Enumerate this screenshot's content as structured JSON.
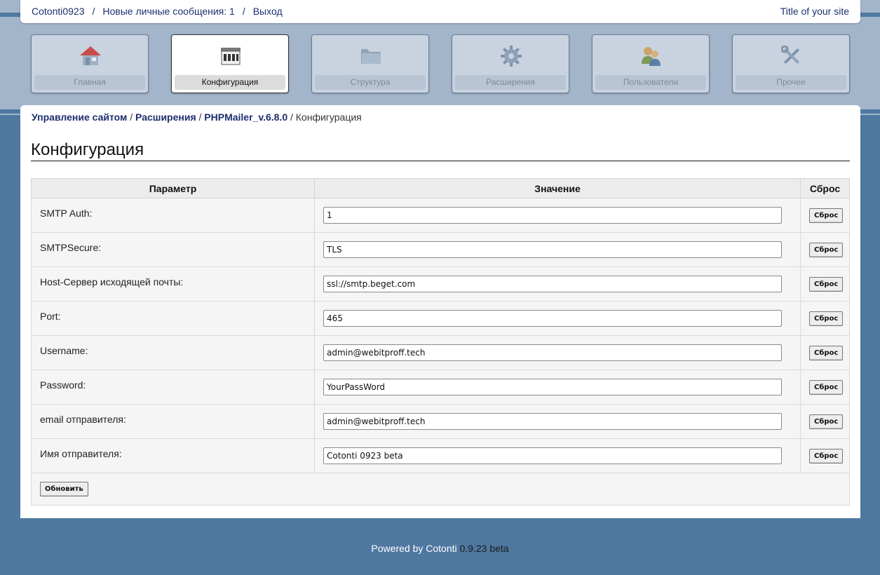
{
  "topbar": {
    "user_link": "Cotonti0923",
    "separator": "/",
    "messages_link": "Новые личные сообщения: 1",
    "logout_link": "Выход",
    "site_title": "Title of your site"
  },
  "tabs": [
    {
      "label": "Главная",
      "icon": "home-icon"
    },
    {
      "label": "Конфигурация",
      "icon": "config-icon",
      "active": true
    },
    {
      "label": "Структура",
      "icon": "folder-icon"
    },
    {
      "label": "Расширения",
      "icon": "gear-icon"
    },
    {
      "label": "Пользователи",
      "icon": "users-icon"
    },
    {
      "label": "Прочее",
      "icon": "tools-icon"
    }
  ],
  "breadcrumb": {
    "items": [
      "Управление сайтом",
      "Расширения",
      "PHPMailer_v.6.8.0"
    ],
    "separator": "/",
    "current": "Конфигурация"
  },
  "page": {
    "title": "Конфигурация"
  },
  "table": {
    "headers": [
      "Параметр",
      "Значение",
      "Сброс"
    ],
    "rows": [
      {
        "param": "SMTP Auth:",
        "value": "1",
        "reset": "Сброс"
      },
      {
        "param": "SMTPSecure:",
        "value": "TLS",
        "reset": "Сброс"
      },
      {
        "param": "Host-Сервер исходящей почты:",
        "value": "ssl://smtp.beget.com",
        "reset": "Сброс"
      },
      {
        "param": "Port:",
        "value": "465",
        "reset": "Сброс"
      },
      {
        "param": "Username:",
        "value": "admin@webitproff.tech",
        "reset": "Сброс"
      },
      {
        "param": "Password:",
        "value": "YourPassWord",
        "reset": "Сброс"
      },
      {
        "param": "email отправителя:",
        "value": "admin@webitproff.tech",
        "reset": "Сброс"
      },
      {
        "param": "Имя отправителя:",
        "value": "Cotonti 0923 beta",
        "reset": "Сброс"
      }
    ],
    "update_button": "Обновить"
  },
  "footer": {
    "powered": "Powered by Cotonti",
    "version": "0.9.23 beta"
  },
  "colors": {
    "accent_blue": "#4f78a1",
    "link_navy": "#1c2f6e",
    "band": "#a3b5ca"
  }
}
